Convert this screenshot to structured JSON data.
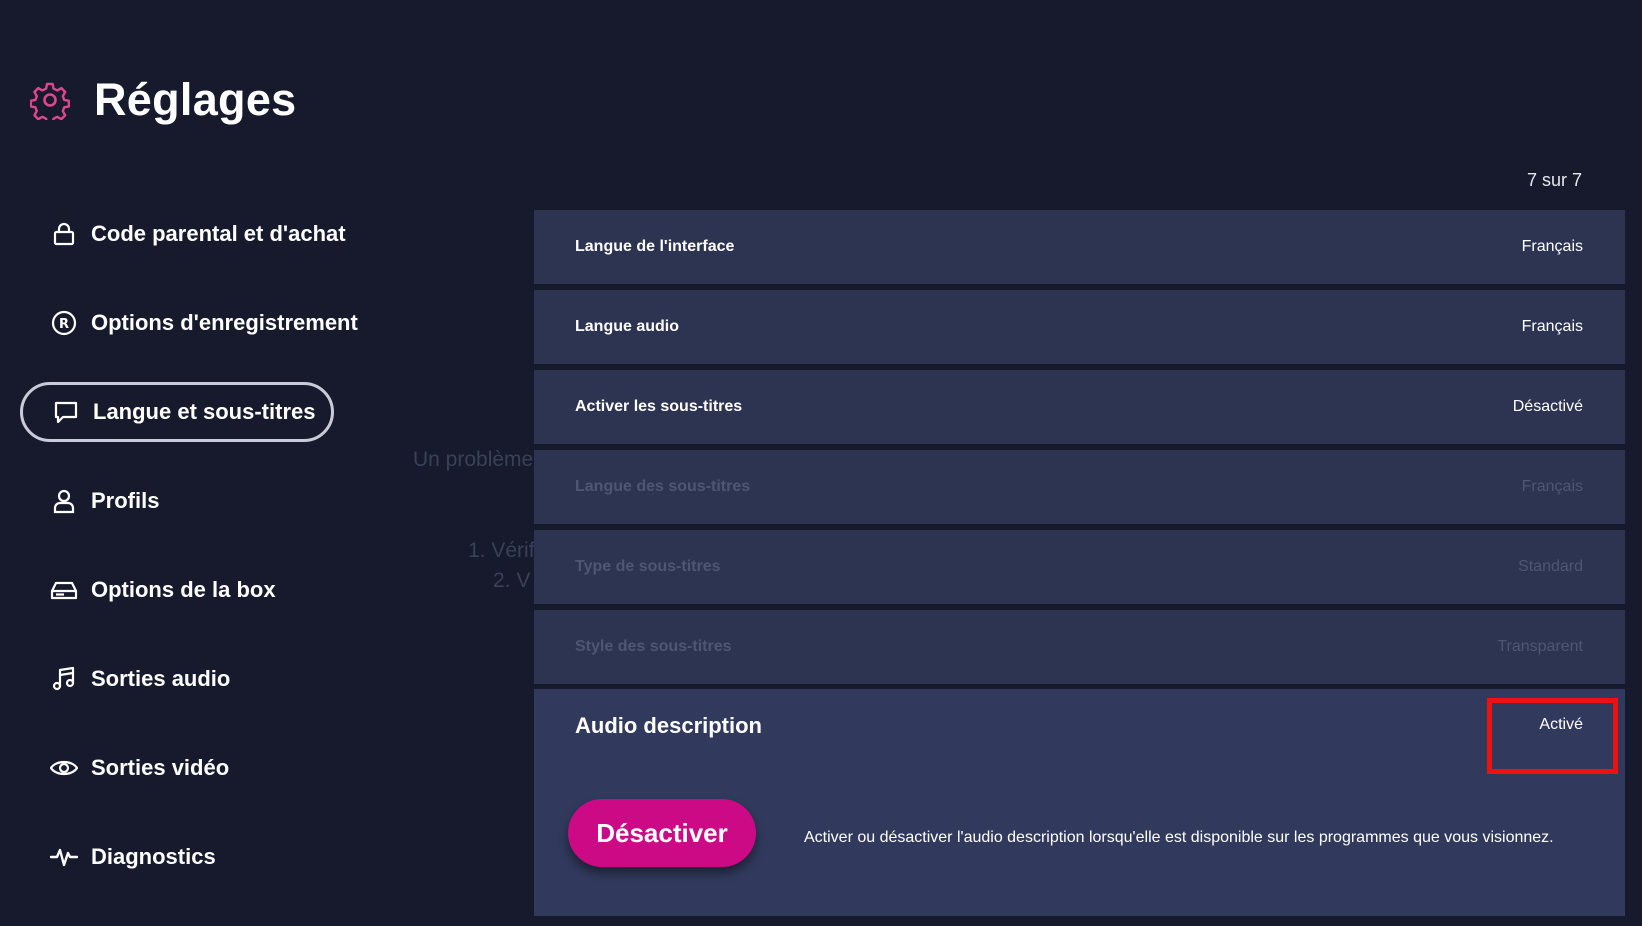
{
  "header": {
    "title": "Réglages",
    "icon": "gear-icon",
    "icon_color": "#e0468f"
  },
  "sidebar": {
    "items": [
      {
        "label": "Code parental et d'achat",
        "icon": "lock-icon"
      },
      {
        "label": "Options d'enregistrement",
        "icon": "record-icon"
      },
      {
        "label": "Langue et sous-titres",
        "icon": "speech-bubble-icon",
        "selected": true
      },
      {
        "label": "Profils",
        "icon": "person-icon"
      },
      {
        "label": "Options de la box",
        "icon": "box-icon"
      },
      {
        "label": "Sorties audio",
        "icon": "music-note-icon"
      },
      {
        "label": "Sorties vidéo",
        "icon": "eye-icon"
      },
      {
        "label": "Diagnostics",
        "icon": "pulse-icon"
      }
    ]
  },
  "background_text": {
    "line1": "Un problème",
    "line2": "1. Vérif",
    "line3": "2. V"
  },
  "panel": {
    "counter": "7 sur 7",
    "rows": [
      {
        "label": "Langue de l'interface",
        "value": "Français",
        "enabled": true
      },
      {
        "label": "Langue audio",
        "value": "Français",
        "enabled": true
      },
      {
        "label": "Activer les sous-titres",
        "value": "Désactivé",
        "enabled": true
      },
      {
        "label": "Langue des sous-titres",
        "value": "Français",
        "enabled": false
      },
      {
        "label": "Type de sous-titres",
        "value": "Standard",
        "enabled": false
      },
      {
        "label": "Style des sous-titres",
        "value": "Transparent",
        "enabled": false
      }
    ],
    "expanded": {
      "label": "Audio description",
      "value": "Activé",
      "button_label": "Désactiver",
      "description": "Activer ou désactiver l'audio description lorsqu'elle est disponible sur les programmes que vous visionnez."
    }
  },
  "colors": {
    "background": "#161a2c",
    "row_background": "#2d3451",
    "expanded_background": "#313a5d",
    "accent": "#cc0a86",
    "highlight": "#ee1111"
  }
}
